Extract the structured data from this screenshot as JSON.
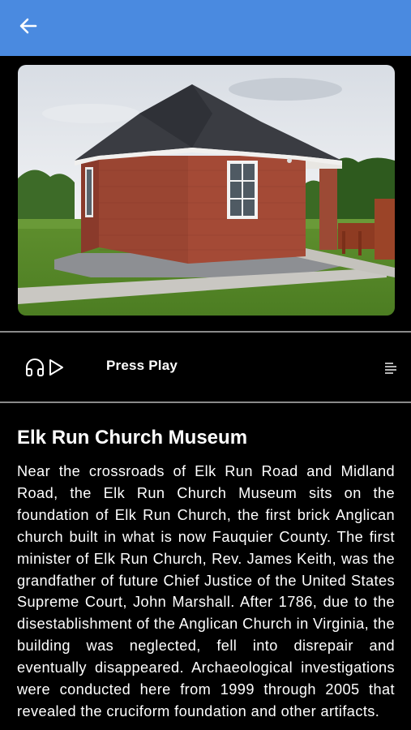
{
  "topbar": {
    "back_icon": "arrow-left-icon",
    "color": "#4a8ae0"
  },
  "photo": {
    "alt": "Elk Run Church Museum"
  },
  "player": {
    "icons": [
      "headphones-icon",
      "play-icon",
      "transcript-lines-icon"
    ],
    "status_label": "Press Play"
  },
  "article": {
    "title": "Elk Run Church Museum",
    "body": "Near the crossroads of Elk Run Road and Midland Road, the Elk Run Church Museum sits on the foundation of Elk Run Church, the first brick Anglican church built in what is now Fauquier County. The first minister of Elk Run Church, Rev. James Keith, was the grandfather of future Chief Justice of the United States Supreme Court, John Marshall. After 1786, due to the disestablishment of the Anglican Church in Virginia, the building was neglected, fell into disrepair and eventually disappeared. Archaeological investigations were conducted here from 1999 through 2005 that revealed the cruciform foundation and other artifacts."
  }
}
